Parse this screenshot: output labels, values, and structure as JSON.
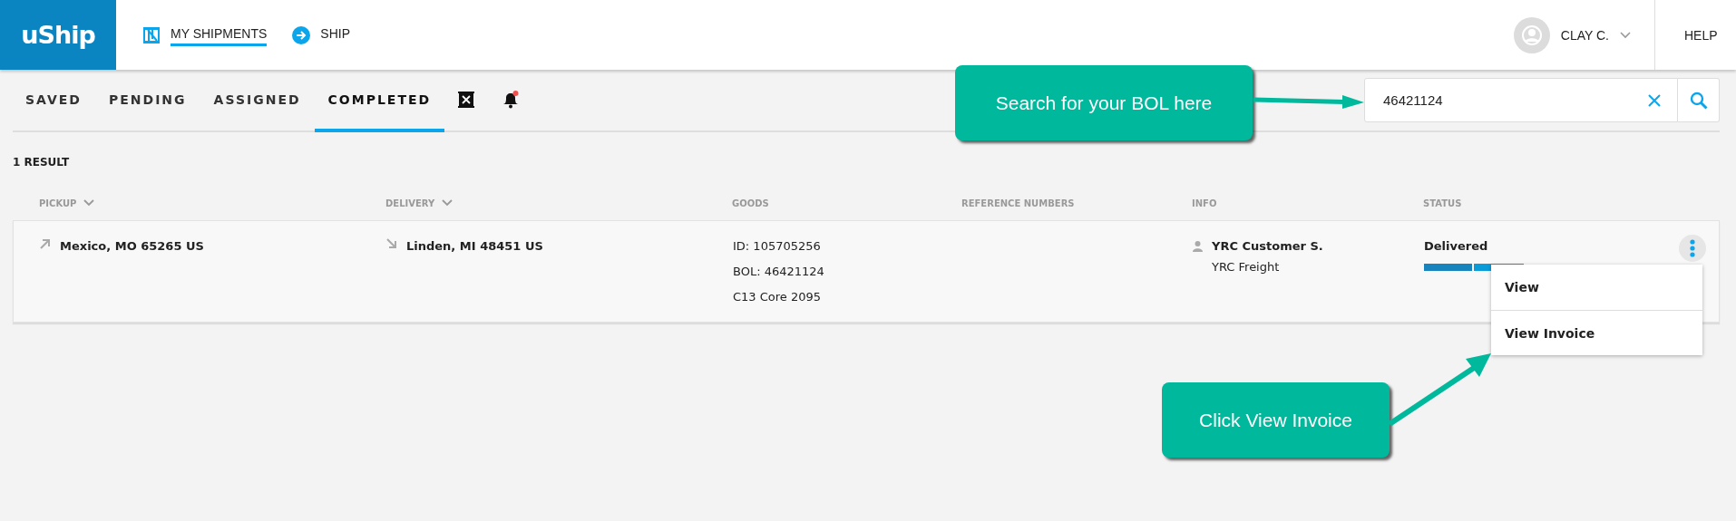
{
  "header": {
    "logo": "uShip",
    "nav": [
      {
        "label": "MY SHIPMENTS",
        "kind": "crate",
        "selected": true
      },
      {
        "label": "SHIP",
        "kind": "arrow",
        "selected": false
      }
    ],
    "user": {
      "name": "CLAY C."
    },
    "help": "HELP"
  },
  "tabs": [
    {
      "kind": "text",
      "label": "SAVED",
      "selected": false
    },
    {
      "kind": "text",
      "label": "PENDING",
      "selected": false
    },
    {
      "kind": "text",
      "label": "ASSIGNED",
      "selected": false
    },
    {
      "kind": "text",
      "label": "COMPLETED",
      "selected": true
    },
    {
      "kind": "cancelled",
      "selected": false
    },
    {
      "kind": "bell",
      "selected": false,
      "unread": true
    }
  ],
  "search": {
    "value": "46421124"
  },
  "result_count": "1 RESULT",
  "table": {
    "columns": [
      {
        "label": "PICKUP",
        "sortable": true
      },
      {
        "label": "DELIVERY",
        "sortable": true
      },
      {
        "label": "GOODS",
        "sortable": false
      },
      {
        "label": "REFERENCE NUMBERS",
        "sortable": false
      },
      {
        "label": "INFO",
        "sortable": false
      },
      {
        "label": "STATUS",
        "sortable": false
      }
    ],
    "rows": [
      {
        "pickup": "Mexico, MO 65265 US",
        "delivery": "Linden, MI 48451 US",
        "goods": [
          "ID: 105705256",
          "BOL: 46421124",
          "C13 Core 2095"
        ],
        "info": {
          "name": "YRC Customer S.",
          "carrier": "YRC Freight"
        },
        "status": {
          "label": "Delivered",
          "level": 1
        }
      }
    ]
  },
  "row_menu": {
    "items": [
      "View",
      "View Invoice"
    ]
  },
  "callouts": [
    {
      "text": "Search for your BOL here"
    },
    {
      "text": "Click View Invoice"
    }
  ]
}
